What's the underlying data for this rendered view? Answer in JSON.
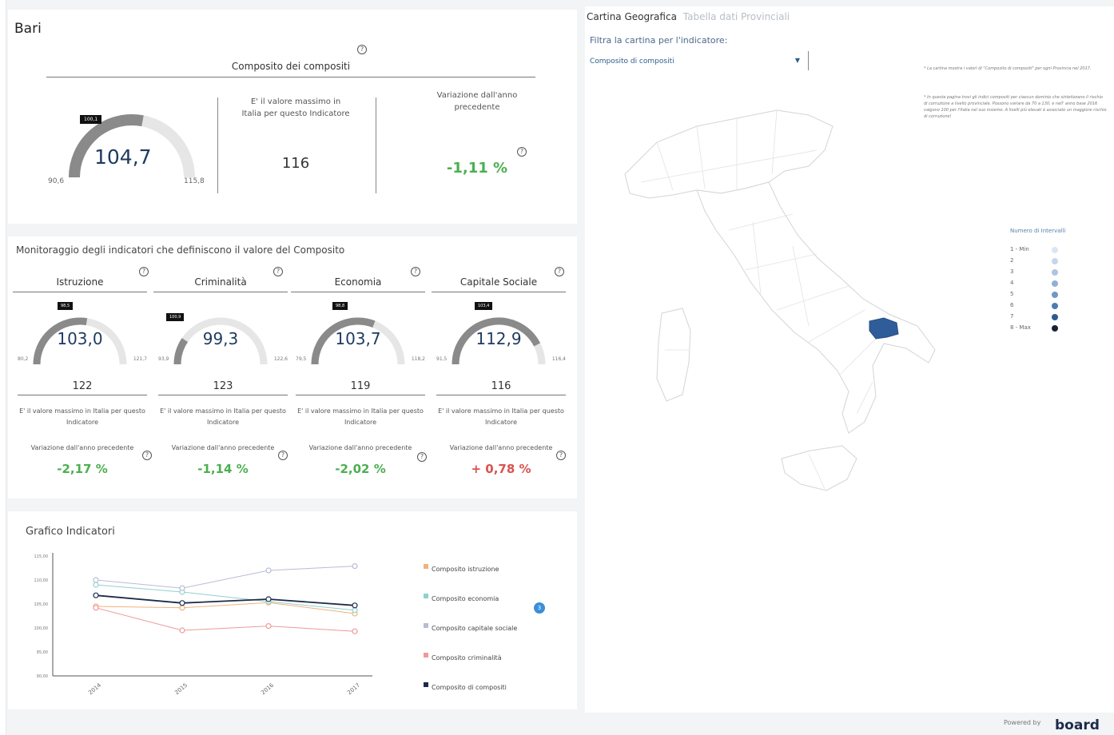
{
  "city": "Bari",
  "composite": {
    "title": "Composito dei compositi",
    "value": "104,7",
    "gauge_fill": 0.56,
    "marker": "100,1",
    "min": "90,6",
    "max": "115,8",
    "desc": "E' il valore massimo in Italia per questo Indicatore",
    "rank": "116",
    "var_label": "Variazione dall'anno precedente",
    "var_value": "-1,11 %",
    "help": "?"
  },
  "monitor": {
    "title": "Monitoraggio degli indicatori che definiscono il valore del Composito",
    "indicators": [
      {
        "title": "Istruzione",
        "value": "103,0",
        "gauge_fill": 0.55,
        "marker": "98,5",
        "min": "80,2",
        "max": "121,7",
        "rank": "122",
        "desc": "E' il valore massimo in Italia per questo Indicatore",
        "var_label": "Variazione dall'anno precedente",
        "var_value": "-2,17 %",
        "var_color": "#4caf50"
      },
      {
        "title": "Criminalità",
        "value": "99,3",
        "gauge_fill": 0.19,
        "marker": "100,9",
        "min": "93,9",
        "max": "122,6",
        "rank": "123",
        "desc": "E' il valore massimo in Italia per questo Indicatore",
        "var_label": "Variazione dall'anno precedente",
        "var_value": "-1,14 %",
        "var_color": "#4caf50"
      },
      {
        "title": "Economia",
        "value": "103,7",
        "gauge_fill": 0.62,
        "marker": "98,8",
        "min": "79,5",
        "max": "118,2",
        "rank": "119",
        "desc": "E' il valore massimo in Italia per questo Indicatore",
        "var_label": "Variazione dall'anno precedente",
        "var_value": "-2,02 %",
        "var_color": "#4caf50"
      },
      {
        "title": "Capitale Sociale",
        "value": "112,9",
        "gauge_fill": 0.85,
        "marker": "103,4",
        "min": "91,5",
        "max": "116,4",
        "rank": "116",
        "desc": "E' il valore massimo in Italia per questo Indicatore",
        "var_label": "Variazione dall'anno precedente",
        "var_value": "+ 0,78 %",
        "var_color": "#d9534f"
      }
    ]
  },
  "chart_section": {
    "title": "Grafico Indicatori",
    "badge": "3"
  },
  "chart_data": {
    "type": "line",
    "title": "Grafico Indicatori",
    "x": [
      "2014",
      "2015",
      "2016",
      "2017"
    ],
    "y_ticks": [
      "115,00",
      "110,00",
      "105,00",
      "100,00",
      "95,00",
      "90,00"
    ],
    "ylim": [
      90,
      115
    ],
    "grid": false,
    "legend_position": "right",
    "series": [
      {
        "name": "Composito istruzione",
        "color": "#f0b27a",
        "values": [
          104.5,
          104.2,
          105.3,
          103.0
        ]
      },
      {
        "name": "Composito economia",
        "color": "#8fd1cd",
        "values": [
          109.0,
          107.5,
          105.5,
          103.7
        ]
      },
      {
        "name": "Composito capitale sociale",
        "color": "#b8bcd6",
        "values": [
          110.0,
          108.3,
          112.0,
          112.9
        ]
      },
      {
        "name": "Composito criminalità",
        "color": "#ee9a9a",
        "values": [
          104.2,
          99.5,
          100.4,
          99.3
        ]
      },
      {
        "name": "Composito di compositi",
        "color": "#1d2b4a",
        "values": [
          106.8,
          105.2,
          106.0,
          104.7
        ]
      }
    ]
  },
  "map_panel": {
    "tab_active": "Cartina Geografica",
    "tab_inactive": "Tabella dati Provinciali",
    "filter_label": "Filtra la cartina per l'indicatore:",
    "selected": "Composito di compositi",
    "note1": "* La cartina mostra i valori di \"Composito di compositi\" per ogni Provincia nel 2017.",
    "note2": "* In questa pagina trovi gli indici compositi per ciascun dominio che sintetizzano il rischio di corruzione a livello provinciale. Possono variare da 70 a 130, e nell' anno base 2016 valgono 100 per l'Italia nel suo insieme. A livelli più elevati è associato un maggiore rischio di corruzione!",
    "intervals_title": "Numero di Intervalli",
    "intervals": [
      {
        "label": "1 - Min",
        "color": "#dbe6f3"
      },
      {
        "label": "2",
        "color": "#c6d6ec"
      },
      {
        "label": "3",
        "color": "#aec4e2"
      },
      {
        "label": "4",
        "color": "#93afd5"
      },
      {
        "label": "5",
        "color": "#7397c6"
      },
      {
        "label": "6",
        "color": "#4f7bb3"
      },
      {
        "label": "7",
        "color": "#2e5a94"
      },
      {
        "label": "8 - Max",
        "color": "#1a2130"
      }
    ],
    "highlight_color": "#2f5d9a"
  },
  "footer": {
    "powered": "Powered by",
    "brand": "board"
  }
}
